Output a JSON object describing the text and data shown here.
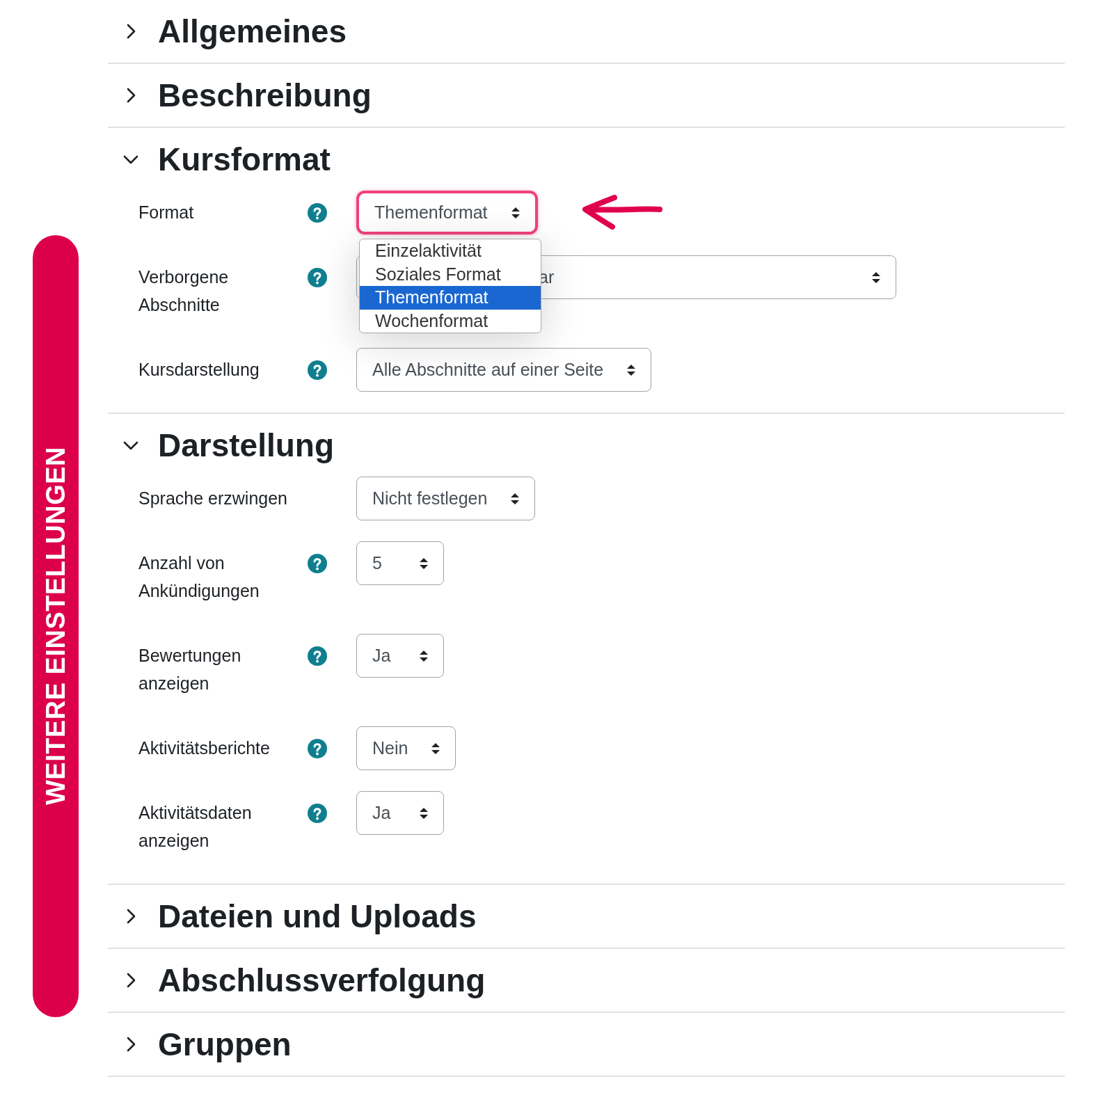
{
  "side_label": "WEITERE EINSTELLUNGEN",
  "sections": [
    {
      "title": "Allgemeines",
      "expanded": false
    },
    {
      "title": "Beschreibung",
      "expanded": false
    },
    {
      "title": "Kursformat",
      "expanded": true,
      "fields": [
        {
          "label": "Format",
          "help": true,
          "value": "Themenformat",
          "highlighted": true,
          "options": [
            {
              "label": "Einzelaktivität",
              "selected": false
            },
            {
              "label": "Soziales Format",
              "selected": false
            },
            {
              "label": "Themenformat",
              "selected": true
            },
            {
              "label": "Wochenformat",
              "selected": false
            }
          ]
        },
        {
          "label": "Verborgene Abschnitte",
          "help": true,
          "value": "ar",
          "highlighted": false
        },
        {
          "label": "Kursdarstellung",
          "help": true,
          "value": "Alle Abschnitte auf einer Seite",
          "highlighted": false
        }
      ]
    },
    {
      "title": "Darstellung",
      "expanded": true,
      "fields": [
        {
          "label": "Sprache erzwingen",
          "help": false,
          "value": "Nicht festlegen",
          "highlighted": false
        },
        {
          "label": "Anzahl von Ankündigungen",
          "help": true,
          "value": "5",
          "highlighted": false
        },
        {
          "label": "Bewertungen anzeigen",
          "help": true,
          "value": "Ja",
          "highlighted": false
        },
        {
          "label": "Aktivitätsberichte",
          "help": true,
          "value": "Nein",
          "highlighted": false
        },
        {
          "label": "Aktivitätsdaten anzeigen",
          "help": true,
          "value": "Ja",
          "highlighted": false
        }
      ]
    },
    {
      "title": "Dateien und Uploads",
      "expanded": false
    },
    {
      "title": "Abschlussverfolgung",
      "expanded": false
    },
    {
      "title": "Gruppen",
      "expanded": false
    }
  ]
}
